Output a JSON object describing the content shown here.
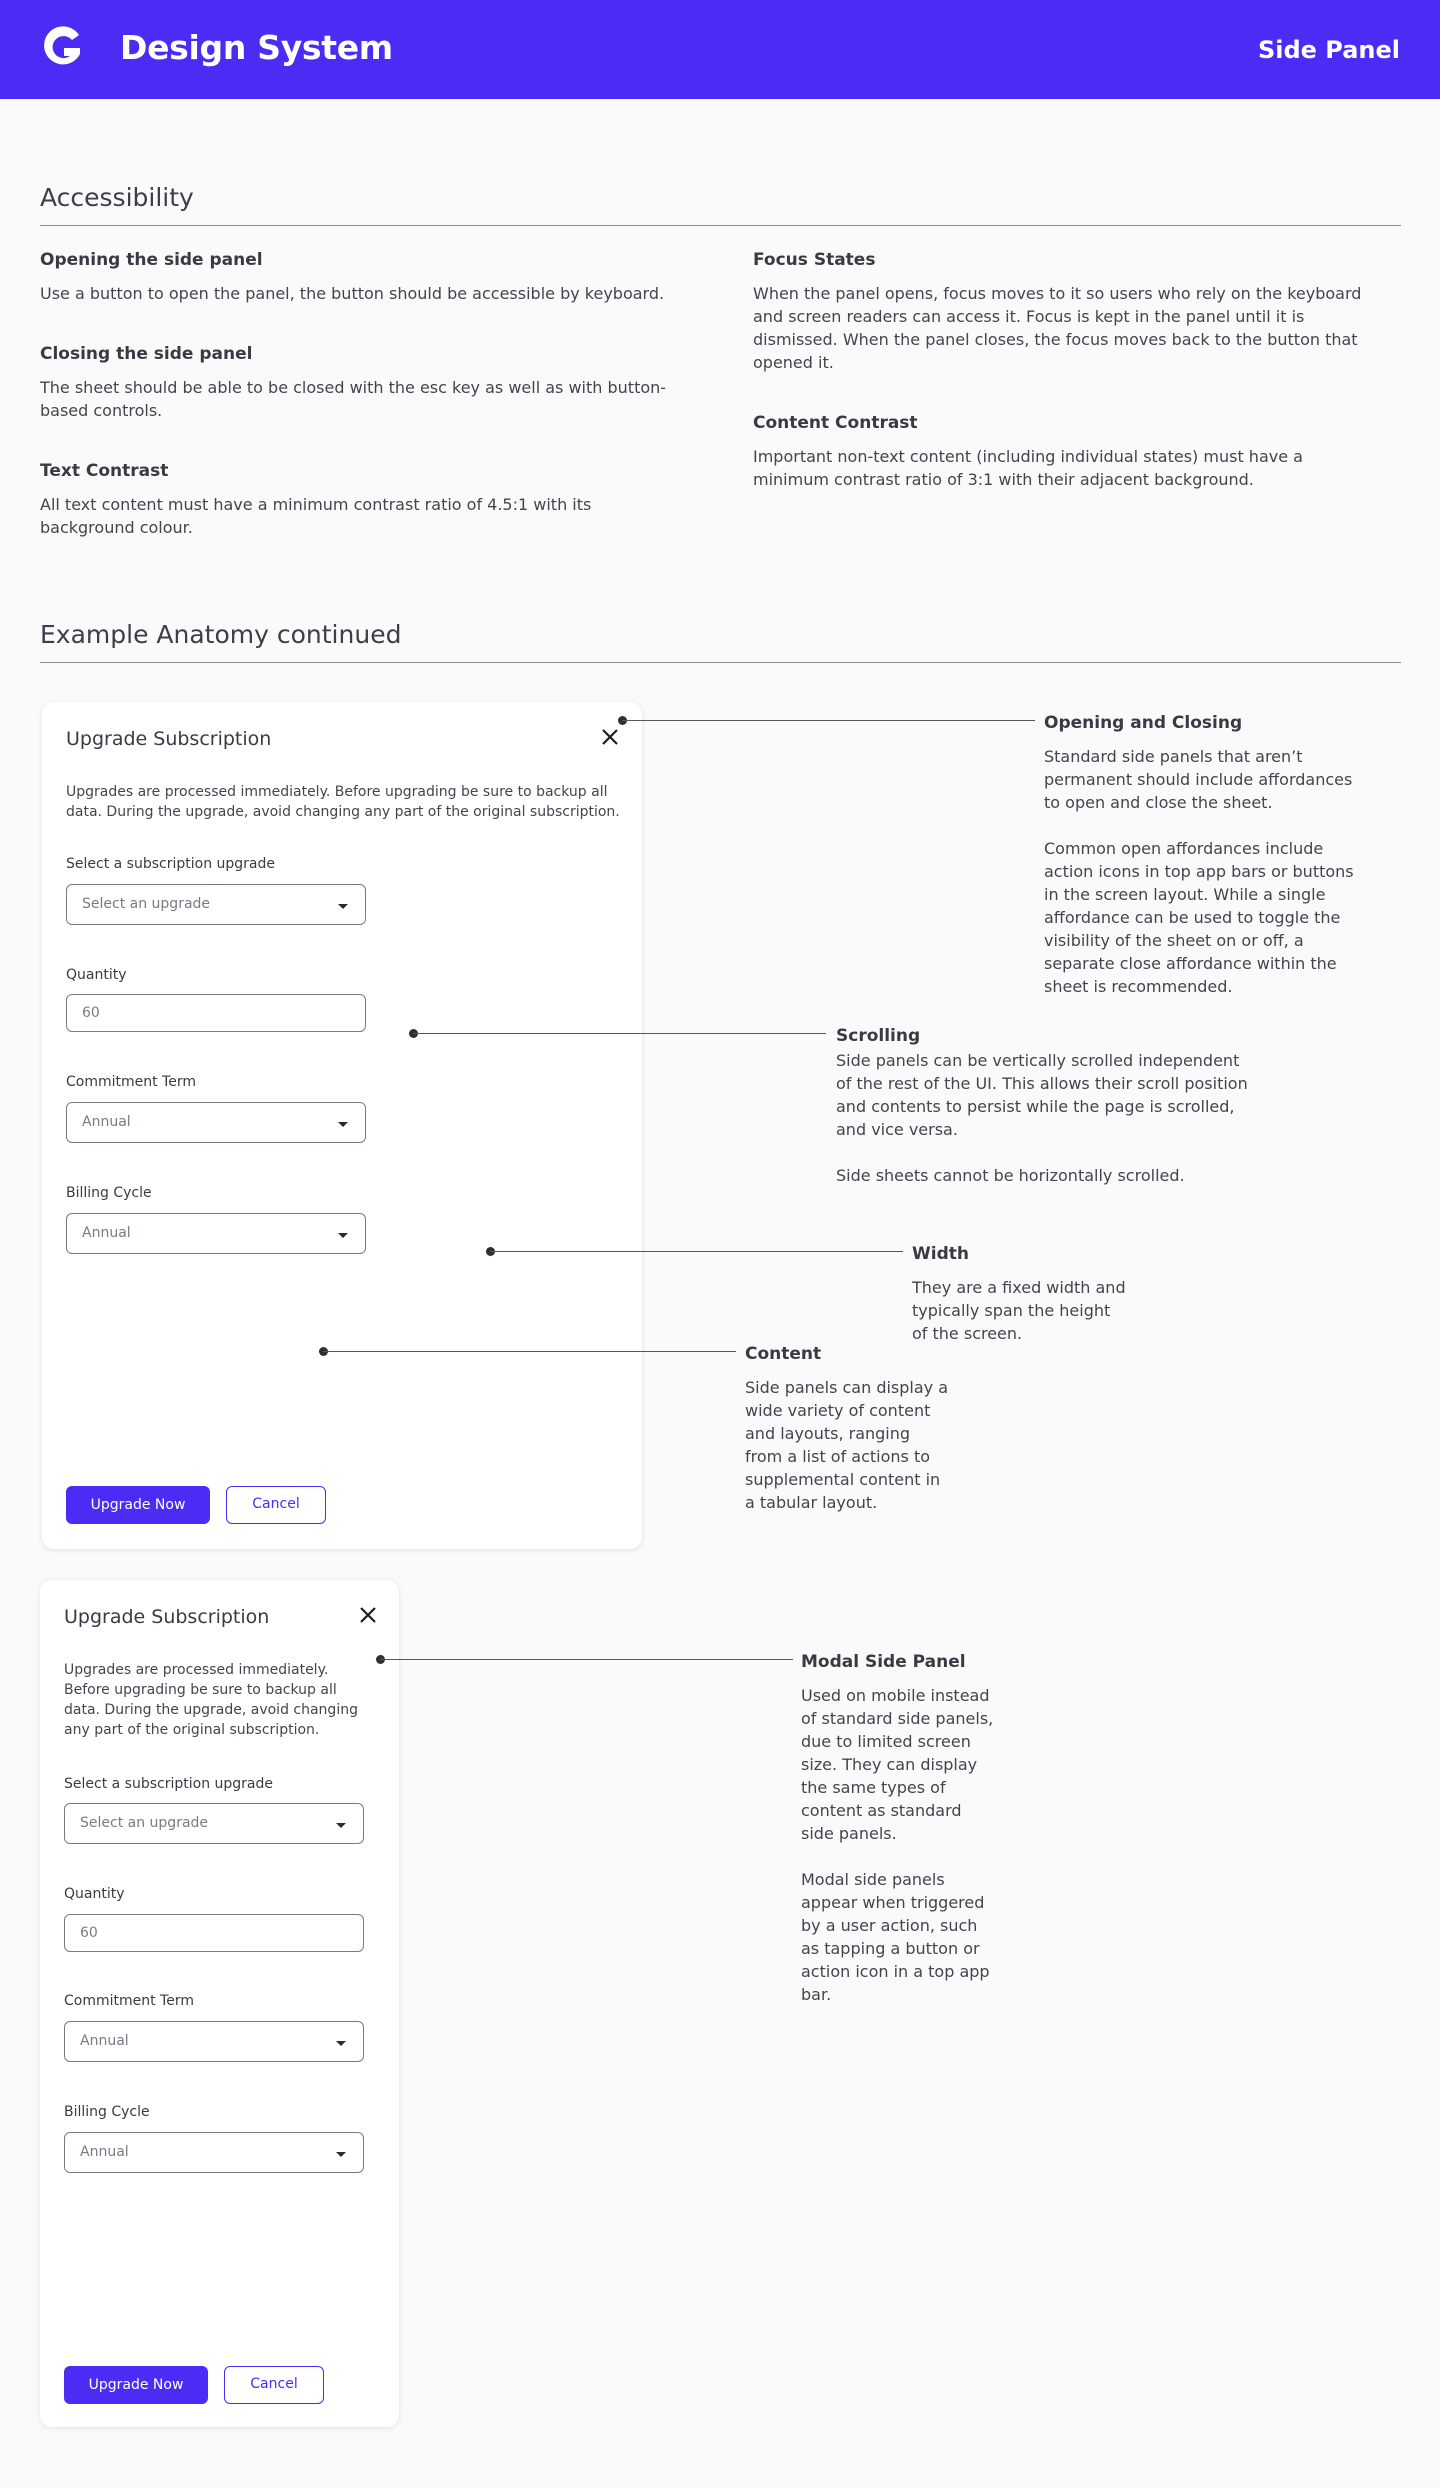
{
  "header": {
    "brand": "Design System",
    "page": "Side Panel",
    "logo_icon": "g-logo-icon",
    "background": "#4a2cf5"
  },
  "accessibility": {
    "title": "Accessibility",
    "items": [
      {
        "heading": "Opening the side panel",
        "body": "Use a button to open the panel, the button should be accessible by keyboard."
      },
      {
        "heading": "Closing the side panel",
        "body": "The sheet should be able to be closed with the esc key as well as with button-based controls."
      },
      {
        "heading": "Text Contrast",
        "body": "All text content must have a minimum contrast ratio of 4.5:1 with its background colour."
      },
      {
        "heading": "Focus States",
        "body": "When the panel opens, focus moves to it so users who rely on the keyboard and screen readers can access it. Focus is kept in the panel until it is dismissed. When the panel closes, the focus moves back to the button that opened it."
      },
      {
        "heading": "Content Contrast",
        "body": "Important non-text content (including individual states) must have a minimum contrast ratio of 3:1 with their adjacent background."
      }
    ]
  },
  "anatomy": {
    "title": "Example Anatomy continued"
  },
  "panel": {
    "title": "Upgrade Subscription",
    "intro": "Upgrades are processed immediately. Before upgrading be sure to backup all data. During the upgrade, avoid changing any part of the original subscription.",
    "fields": [
      {
        "label": "Select a subscription upgrade",
        "value": "Select an upgrade",
        "type": "select"
      },
      {
        "label": "Quantity",
        "value": "60",
        "type": "input"
      },
      {
        "label": "Commitment Term",
        "value": "Annual",
        "type": "select"
      },
      {
        "label": "Billing Cycle",
        "value": "Annual",
        "type": "select"
      }
    ],
    "primary_button": "Upgrade Now",
    "secondary_button": "Cancel"
  },
  "annotations": [
    {
      "heading": "Opening and Closing",
      "body": "Standard side panels that aren’t permanent should include affordances to open and close the sheet.\n\nCommon open affordances include action icons in top app bars or buttons in the screen layout. While a single affordance can be used to toggle the visibility of the sheet on or off, a separate close affordance within the sheet is recommended."
    },
    {
      "heading": "Scrolling",
      "body": "Side panels can be vertically scrolled independent of the rest of the UI. This allows their scroll position and contents to persist while the page is scrolled, and vice versa.\n\nSide sheets cannot be horizontally scrolled."
    },
    {
      "heading": "Width",
      "body": "They are a fixed width and typically span the height of the screen."
    },
    {
      "heading": "Content",
      "body": "Side panels can display a wide variety of content and layouts, ranging from a list of actions to supplemental content in a tabular layout."
    },
    {
      "heading": "Modal Side Panel",
      "body": "Used on mobile instead of standard side panels, due to limited screen size. They can display the same types of content as standard side panels.\n\nModal side panels appear when triggered by a user action, such as tapping a button or action icon in a top app bar."
    }
  ]
}
